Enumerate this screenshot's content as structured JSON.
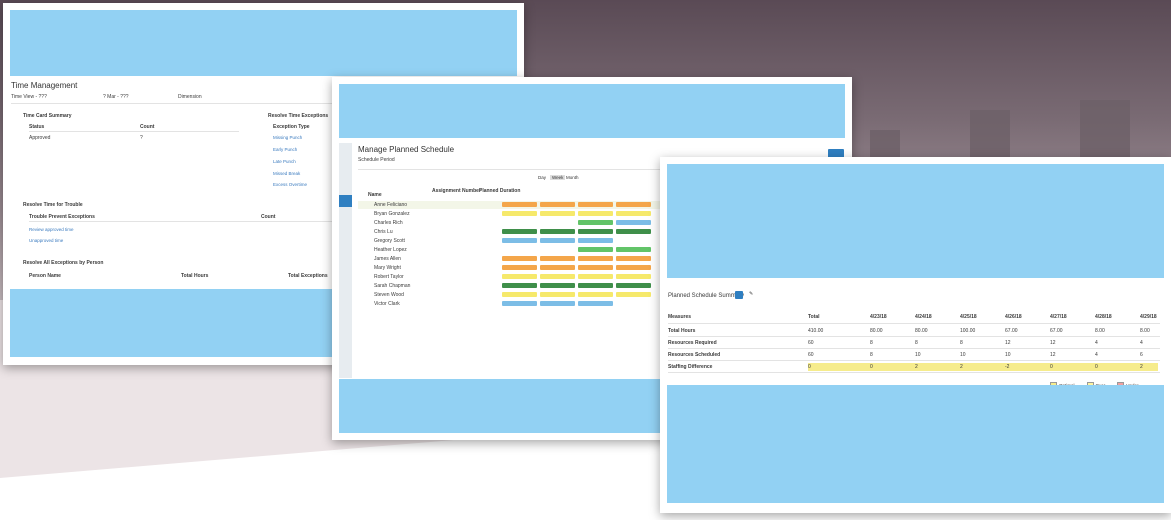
{
  "card1": {
    "title": "Time Management",
    "toolbar": [
      "Time View - ???",
      "? Mar - ???",
      "Dimension"
    ],
    "left_panel": {
      "header": "Time Card Summary",
      "cols": [
        "Status",
        "Count"
      ],
      "rows": [
        [
          "Approved",
          "?"
        ]
      ]
    },
    "right_panel": {
      "header": "Resolve Time Exceptions",
      "col": "Exception Type",
      "links": [
        "Missing Punch",
        "Early Punch",
        "Late Punch",
        "Missed Break",
        "Excess Overtime"
      ]
    },
    "mid_panel": {
      "header": "Resolve Time for Trouble",
      "cols": [
        "Trouble Prevent Exceptions",
        "Count"
      ],
      "links": [
        "Review approved time",
        "Unapproved time"
      ]
    },
    "bottom_panel": {
      "header": "Resolve All Exceptions by Person",
      "cols": [
        "Person Name",
        "Total Hours",
        "Total Exceptions"
      ]
    }
  },
  "card2": {
    "title": "Manage Planned Schedule",
    "subtitle": "Schedule Period",
    "tabs": [
      "Day",
      "Week",
      "Month"
    ],
    "cols": [
      "Name",
      "Assignment Number",
      "Planned Duration"
    ],
    "people": [
      "Anne Feliciano",
      "Bryan Gonzalez",
      "Charles Rich",
      "Chris Lu",
      "Gregory Scott",
      "Heather Lopez",
      "James Allen",
      "Mary Wright",
      "Robert Taylor",
      "Sarah Chapman",
      "Steven Wood",
      "Victor Clark"
    ]
  },
  "card3": {
    "section": "Planned Schedule Summary",
    "col_header": "Measures",
    "cols": [
      "Total",
      "4/23/18",
      "4/24/18",
      "4/25/18",
      "4/26/18",
      "4/27/18",
      "4/28/18",
      "4/29/18"
    ],
    "rows": [
      {
        "label": "Total Hours",
        "vals": [
          "410.00",
          "80.00",
          "80.00",
          "100.00",
          "67.00",
          "67.00",
          "8.00",
          "8.00"
        ]
      },
      {
        "label": "Resources Required",
        "vals": [
          "60",
          "8",
          "8",
          "8",
          "12",
          "12",
          "4",
          "4"
        ]
      },
      {
        "label": "Resources Scheduled",
        "vals": [
          "60",
          "8",
          "10",
          "10",
          "10",
          "12",
          "4",
          "6"
        ]
      },
      {
        "label": "Staffing Difference",
        "vals": [
          "0",
          "0",
          "2",
          "2",
          "-2",
          "0",
          "0",
          "2"
        ]
      }
    ],
    "legend": [
      "Optimal",
      "Over",
      "Under"
    ]
  },
  "colors": {
    "placeholder": "#92d1f3",
    "accent": "#2f7fc1",
    "orange": "#f4a64a",
    "yellow": "#f6e96b",
    "green": "#62c468",
    "dgreen": "#3f8f4a",
    "blue": "#7cbde6"
  }
}
